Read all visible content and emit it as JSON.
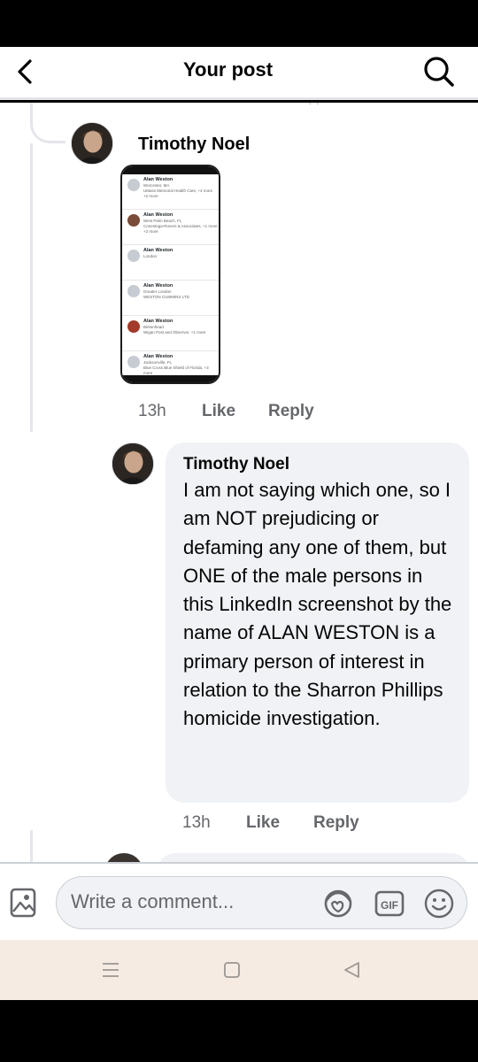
{
  "header": {
    "title": "Your post"
  },
  "comments": [
    {
      "author": "Timothy Noel",
      "time": "13h",
      "like": "Like",
      "reply": "Reply"
    },
    {
      "author": "Timothy Noel",
      "text": "I am not saying which one, so I am NOT prejudicing or defaming any one of them, but ONE of the male persons in this LinkedIn screenshot by the name of ALAN WESTON is a primary person of interest in relation to the Sharron Phillips homicide investigation.",
      "time": "13h",
      "like": "Like",
      "reply": "Reply"
    }
  ],
  "attachment_screenshot": {
    "rows": [
      {
        "name": "Alan Weston",
        "lines": [
          "Worcester, MA",
          "UMass Memorial Health Care, +4 more",
          "+2 more"
        ]
      },
      {
        "name": "Alan Weston",
        "lines": [
          "West Palm Beach, FL",
          "Conestoga-Rovers & Associates, +1 more",
          "+2 more"
        ]
      },
      {
        "name": "Alan Weston",
        "lines": [
          "London"
        ]
      },
      {
        "name": "Alan Weston",
        "lines": [
          "Greater London",
          "WESTON CUMMINS LTD"
        ]
      },
      {
        "name": "Alan Weston",
        "lines": [
          "Birkenhead",
          "Wigan Post and Observer, +1 more"
        ]
      },
      {
        "name": "Alan Weston",
        "lines": [
          "Jacksonville, FL",
          "Blue Cross Blue Shield of Florida, +3 more"
        ]
      }
    ]
  },
  "composer": {
    "placeholder": "Write a comment..."
  },
  "icons": [
    "back-arrow-icon",
    "search-icon",
    "photo-icon",
    "avatar-sticker-icon",
    "gif-icon",
    "emoji-icon",
    "menu-icon",
    "home-square-icon",
    "back-triangle-icon"
  ]
}
